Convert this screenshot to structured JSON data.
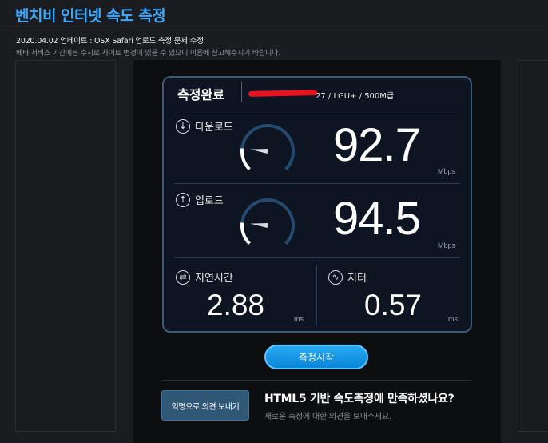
{
  "page": {
    "title": "벤치비 인터넷 속도 측정",
    "notice": "2020.04.02 업데이트 : OSX Safari 업로드 측정 문제 수정",
    "subnotice": "베타 서비스 기간에는 수시로 사이트 변경이 있을 수 있으니 이용에 참고해주시기 바랍니다."
  },
  "result": {
    "status": "측정완료",
    "isp_info": "27 / LGU+ / 500M급",
    "download": {
      "label": "다운로드",
      "value": "92.7",
      "unit": "Mbps",
      "gauge_level": 0.19,
      "icon": "download-arrow-icon"
    },
    "upload": {
      "label": "업로드",
      "value": "94.5",
      "unit": "Mbps",
      "gauge_level": 0.19,
      "icon": "upload-arrow-icon"
    },
    "latency": {
      "label": "지연시간",
      "value": "2.88",
      "unit": "ms",
      "icon": "swap-arrows-icon"
    },
    "jitter": {
      "label": "지터",
      "value": "0.57",
      "unit": "ms",
      "icon": "pulse-wave-icon"
    }
  },
  "actions": {
    "start": "측정시작",
    "feedback": "익명으로 의견 보내기"
  },
  "survey": {
    "question": "HTML5 기반 속도측정에 만족하셨나요?",
    "sub": "새로운 측정에 대한 의견을 보내주세요."
  },
  "colors": {
    "accent": "#3aa9ff",
    "button": "#1598e5",
    "card_border": "#3b5a78",
    "redaction": "#e8131f"
  }
}
